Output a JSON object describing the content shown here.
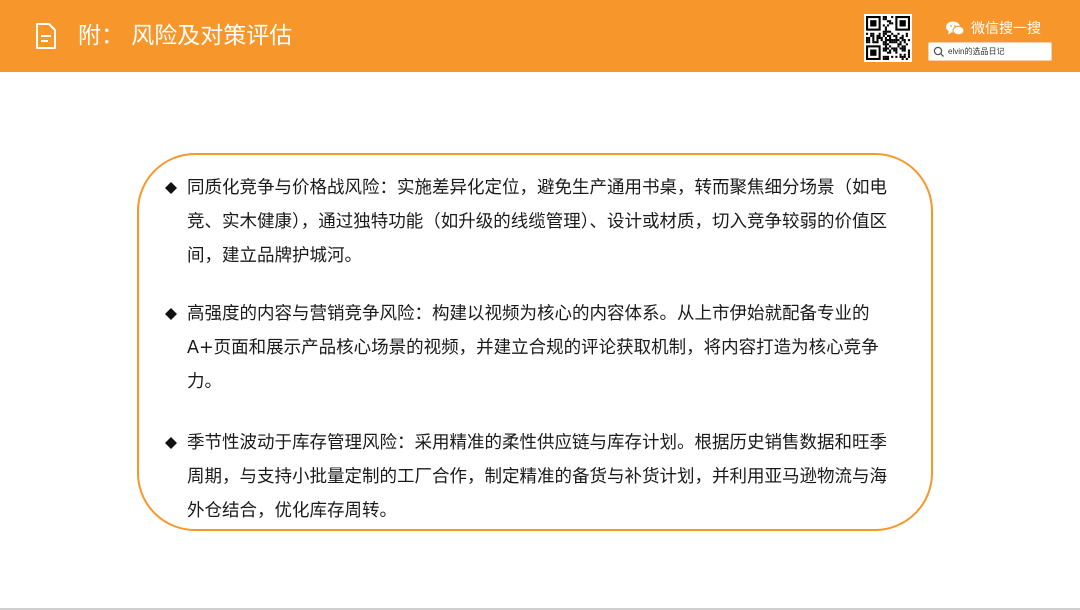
{
  "header": {
    "title": "附：  风险及对策评估",
    "wechat_label": "微信搜一搜",
    "search_text": "elvin的选品日记",
    "icons": [
      "document-icon",
      "qr-code-icon",
      "wechat-icon",
      "search-icon"
    ],
    "accent_color": "#f7972b"
  },
  "risks": [
    {
      "text": "同质化竞争与价格战风险：实施差异化定位，避免生产通用书桌，转而聚焦细分场景（如电竞、实木健康），通过独特功能（如升级的线缆管理）、设计或材质，切入竞争较弱的价值区间，建立品牌护城河。"
    },
    {
      "text": "高强度的内容与营销竞争风险：构建以视频为核心的内容体系。从上市伊始就配备专业的A+页面和展示产品核心场景的视频，并建立合规的评论获取机制，将内容打造为核心竞争力。"
    },
    {
      "text": "季节性波动于库存管理风险：采用精准的柔性供应链与库存计划。根据历史销售数据和旺季周期，与支持小批量定制的工厂合作，制定精准的备货与补货计划，并利用亚马逊物流与海外仓结合，优化库存周转。"
    }
  ]
}
